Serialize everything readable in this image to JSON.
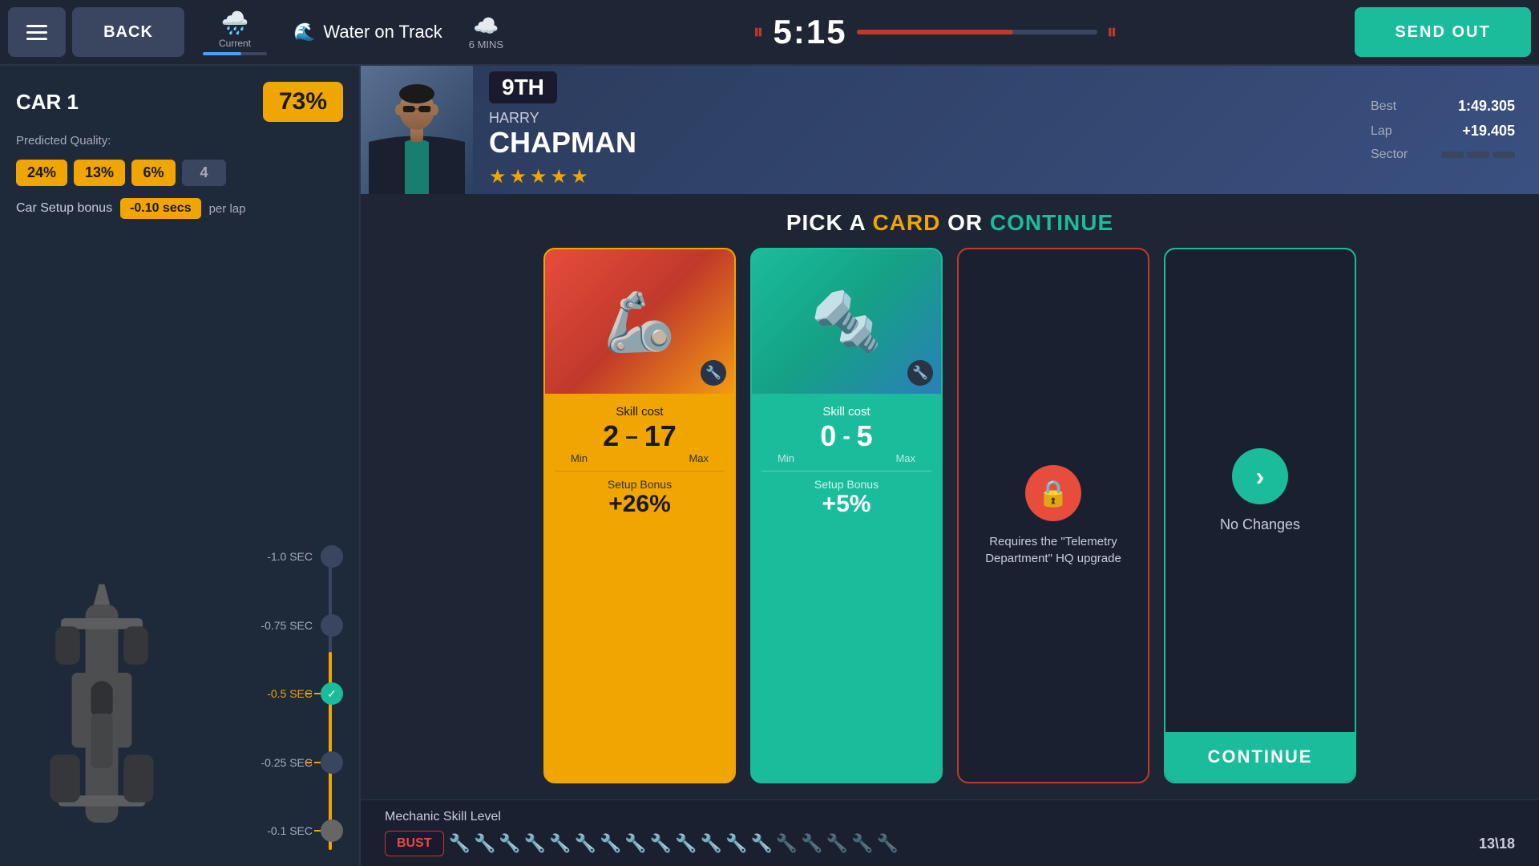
{
  "topbar": {
    "back_label": "BACK",
    "current_label": "Current",
    "weather_text": "Water on Track",
    "next_time": "6 MINS",
    "timer": "5:15",
    "send_out_label": "SEND OUT"
  },
  "left_panel": {
    "car_title": "CAR 1",
    "quality_percent": "73%",
    "predicted_quality_label": "Predicted Quality:",
    "pills": [
      "24%",
      "13%",
      "6%",
      "4"
    ],
    "setup_bonus_label": "Car Setup bonus",
    "setup_bonus_value": "-0.10 secs",
    "per_lap": "per lap",
    "slider_ticks": [
      "-1.0 SEC",
      "-0.75 SEC",
      "-0.5 SEC",
      "-0.25 SEC",
      "-0.1 SEC"
    ]
  },
  "driver": {
    "position": "9TH",
    "first_name": "HARRY",
    "last_name": "CHAPMAN",
    "stars": 5,
    "best_label": "Best",
    "best_value": "1:49.305",
    "lap_label": "Lap",
    "lap_value": "+19.405",
    "sector_label": "Sector"
  },
  "card_area": {
    "title_prefix": "PICK A ",
    "card_word": "CARD",
    "title_mid": " OR ",
    "continue_word": "CONTINUE",
    "card1": {
      "skill_cost_label": "Skill cost",
      "min": "2",
      "dash": "–",
      "max": "17",
      "min_label": "Min",
      "max_label": "Max",
      "setup_bonus_label": "Setup Bonus",
      "setup_bonus_value": "+26%"
    },
    "card2": {
      "skill_cost_label": "Skill cost",
      "min": "0",
      "dash": "-",
      "max": "5",
      "min_label": "Min",
      "max_label": "Max",
      "setup_bonus_label": "Setup Bonus",
      "setup_bonus_value": "+5%"
    },
    "card3": {
      "locked_text": "Requires the \"Telemetry Department\" HQ upgrade"
    },
    "card4": {
      "no_changes_label": "No Changes",
      "continue_label": "CONTINUE"
    }
  },
  "bottom": {
    "mechanic_level_label": "Mechanic Skill Level",
    "bust_label": "BUST",
    "mechanic_count": "13\\18",
    "wrenches_active": 13,
    "wrenches_total": 18
  }
}
